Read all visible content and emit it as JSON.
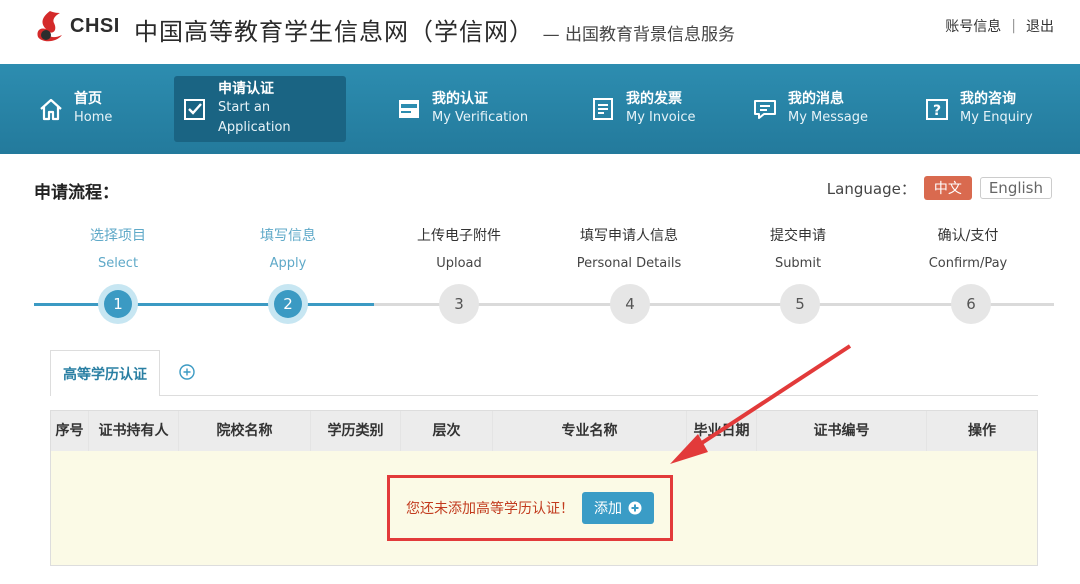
{
  "header": {
    "logo_text": "CHSI",
    "site_title": "中国高等教育学生信息网（学信网）",
    "site_subtitle": "— 出国教育背景信息服务",
    "account_link": "账号信息",
    "separator": "|",
    "logout_link": "退出"
  },
  "nav": [
    {
      "cn": "首页",
      "en": "Home",
      "icon": "home-icon"
    },
    {
      "cn": "申请认证",
      "en": "Start an Application",
      "icon": "checkbox-icon"
    },
    {
      "cn": "我的认证",
      "en": "My Verification",
      "icon": "certificate-icon"
    },
    {
      "cn": "我的发票",
      "en": "My Invoice",
      "icon": "invoice-icon"
    },
    {
      "cn": "我的消息",
      "en": "My Message",
      "icon": "message-icon"
    },
    {
      "cn": "我的咨询",
      "en": "My Enquiry",
      "icon": "question-icon"
    }
  ],
  "process": {
    "label": "申请流程：",
    "language_label": "Language：",
    "lang_zh": "中文",
    "lang_en": "English"
  },
  "steps": [
    {
      "cn": "选择项目",
      "en": "Select",
      "num": "1",
      "status": "done"
    },
    {
      "cn": "填写信息",
      "en": "Apply",
      "num": "2",
      "status": "done"
    },
    {
      "cn": "上传电子附件",
      "en": "Upload",
      "num": "3",
      "status": "todo"
    },
    {
      "cn": "填写申请人信息",
      "en": "Personal Details",
      "num": "4",
      "status": "todo"
    },
    {
      "cn": "提交申请",
      "en": "Submit",
      "num": "5",
      "status": "todo"
    },
    {
      "cn": "确认/支付",
      "en": "Confirm/Pay",
      "num": "6",
      "status": "todo"
    }
  ],
  "tabs": {
    "active": "高等学历认证"
  },
  "table": {
    "headers": [
      "序号",
      "证书持有人",
      "院校名称",
      "学历类别",
      "层次",
      "专业名称",
      "毕业日期",
      "证书编号",
      "操作"
    ],
    "empty_message": "您还未添加高等学历认证！",
    "add_button": "添加"
  },
  "colors": {
    "nav_bg": "#2d8db0",
    "nav_active": "#1a6483",
    "accent": "#3b9ac3",
    "lang_active": "#d96a4f",
    "annotation": "#e23a3a"
  }
}
